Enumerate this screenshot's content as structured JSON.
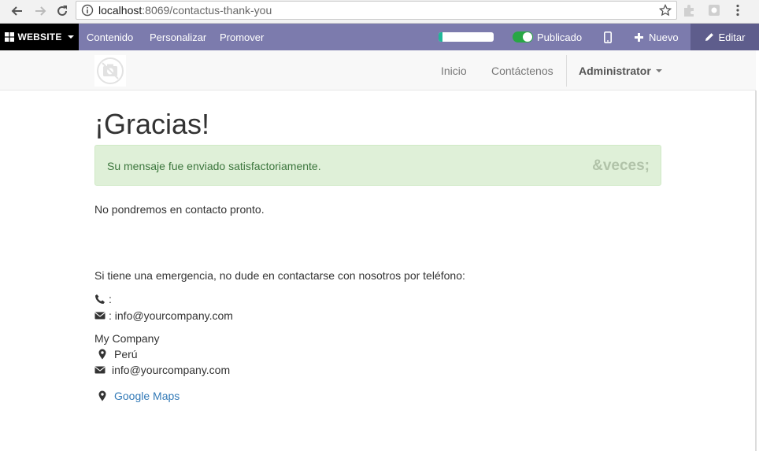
{
  "browser": {
    "url_host": "localhost",
    "url_rest": ":8069/contactus-thank-you"
  },
  "editbar": {
    "website_label": "WEBSITE",
    "menu": [
      "Contenido",
      "Personalizar",
      "Promover"
    ],
    "seo_progress": 0.07,
    "published_label": "Publicado",
    "new_label": "Nuevo",
    "edit_label": "Editar"
  },
  "site_nav": {
    "items": [
      "Inicio",
      "Contáctenos"
    ],
    "user": "Administrator"
  },
  "page": {
    "title": "¡Gracias!",
    "alert_message": "Su mensaje fue enviado satisfactoriamente.",
    "alert_close": "&veces;",
    "contact_soon": "No pondremos en contacto pronto.",
    "emergency": "Si tiene una emergencia, no dude en contactarse con nosotros por teléfono:",
    "phone_line": ":",
    "email_line": ": info@yourcompany.com",
    "company_name": "My Company",
    "country": "Perú",
    "company_email": "info@yourcompany.com",
    "maps_link": "Google Maps"
  },
  "colors": {
    "editbar": "#7c7bad",
    "alert_bg": "#dff0d8",
    "alert_text": "#3c763d",
    "link": "#337ab7"
  }
}
